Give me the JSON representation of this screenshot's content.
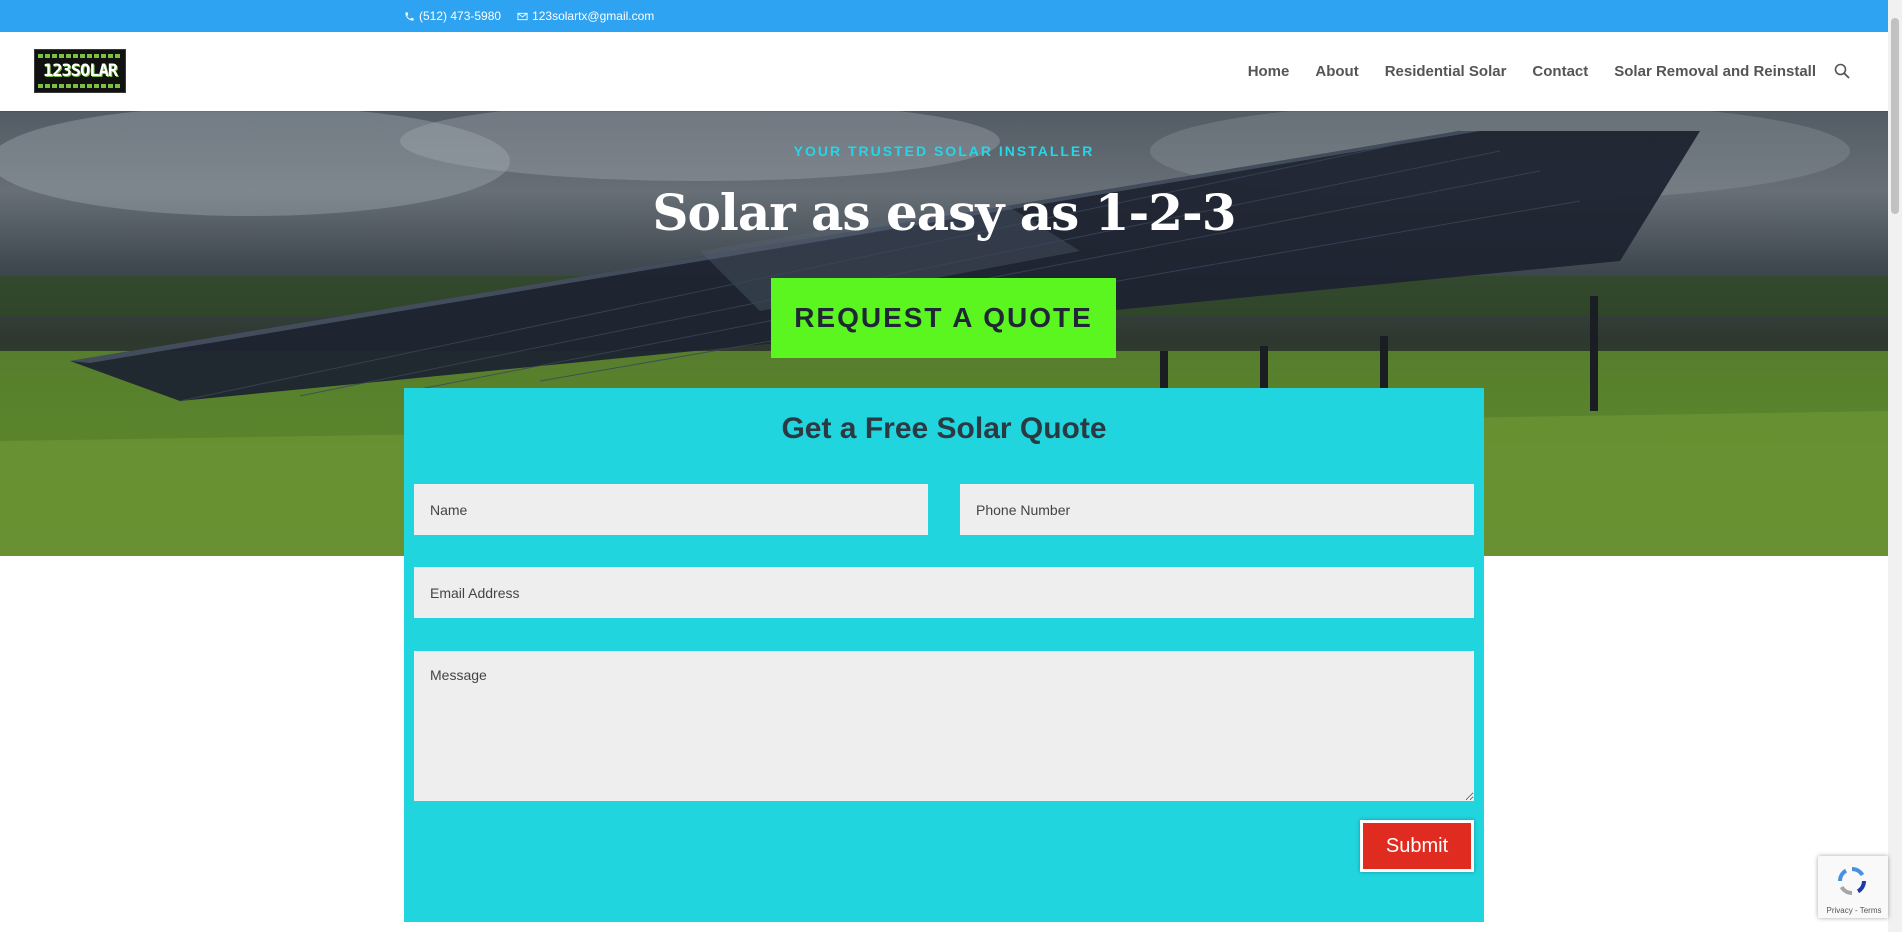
{
  "topbar": {
    "phone": "(512) 473-5980",
    "email": "123solartx@gmail.com"
  },
  "header": {
    "logo_text": "123SOLAR",
    "nav": [
      {
        "label": "Home"
      },
      {
        "label": "About"
      },
      {
        "label": "Residential Solar"
      },
      {
        "label": "Contact"
      },
      {
        "label": "Solar Removal and Reinstall"
      }
    ]
  },
  "hero": {
    "kicker": "YOUR TRUSTED SOLAR INSTALLER",
    "title": "Solar as easy as 1-2-3",
    "cta_label": "REQUEST A QUOTE"
  },
  "form": {
    "title": "Get a Free Solar Quote",
    "name_placeholder": "Name",
    "phone_placeholder": "Phone Number",
    "email_placeholder": "Email Address",
    "message_placeholder": "Message",
    "submit_label": "Submit"
  },
  "recaptcha": {
    "terms": "Privacy - Terms"
  },
  "colors": {
    "topbar": "#2ea3f2",
    "kicker": "#25d6e6",
    "cta": "#5bf520",
    "form_bg": "#20d5de",
    "submit": "#e02b20"
  }
}
